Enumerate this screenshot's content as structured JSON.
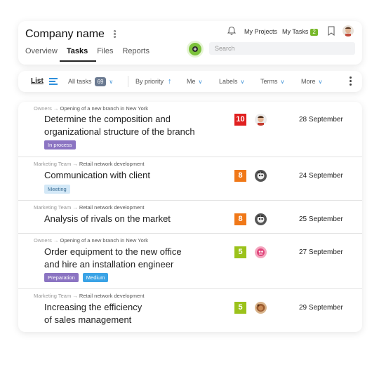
{
  "header": {
    "company_name": "Company name",
    "tabs": [
      {
        "label": "Overview",
        "active": false
      },
      {
        "label": "Tasks",
        "active": true
      },
      {
        "label": "Files",
        "active": false
      },
      {
        "label": "Reports",
        "active": false
      }
    ],
    "my_projects": "My Projects",
    "my_tasks": "My Tasks",
    "my_tasks_count": "2",
    "search_placeholder": "Search"
  },
  "toolbar": {
    "list_label": "List",
    "all_tasks_label": "All tasks",
    "all_tasks_count": "69",
    "sort_label": "By priority",
    "me_label": "Me",
    "labels_label": "Labels",
    "terms_label": "Terms",
    "more_label": "More"
  },
  "tasks": [
    {
      "crumb_a": "Owners",
      "crumb_b": "Opening of a new branch in New York",
      "title_1": "Determine the composition and",
      "title_2": "organizational structure of the branch",
      "labels": [
        {
          "text": "In process",
          "bg": "#8b74c2",
          "color": "#ffffff"
        }
      ],
      "priority": "10",
      "priority_color": "#e02020",
      "date": "28 September"
    },
    {
      "crumb_a": "Marketing Team",
      "crumb_b": "Retail network development",
      "title_1": "Communication with client",
      "title_2": "",
      "labels": [
        {
          "text": "Meeting",
          "bg": "#d3e8f7",
          "color": "#3a6d94"
        }
      ],
      "priority": "8",
      "priority_color": "#f07818",
      "date": "24 September"
    },
    {
      "crumb_a": "Marketing Team",
      "crumb_b": "Retail network development",
      "title_1": "Analysis of rivals on the market",
      "title_2": "",
      "labels": [],
      "priority": "8",
      "priority_color": "#f07818",
      "date": "25 September"
    },
    {
      "crumb_a": "Owners",
      "crumb_b": "Opening of a new branch in New York",
      "title_1": "Order equipment to the new office",
      "title_2": "and hire an  installation engineer",
      "labels": [
        {
          "text": "Preparation",
          "bg": "#8b74c2",
          "color": "#ffffff"
        },
        {
          "text": "Medium",
          "bg": "#3aa3e6",
          "color": "#ffffff"
        }
      ],
      "priority": "5",
      "priority_color": "#9bc21b",
      "date": "27 September"
    },
    {
      "crumb_a": "Marketing Team",
      "crumb_b": "Retail network development",
      "title_1": "Increasing the efficiency",
      "title_2": "of sales management",
      "labels": [],
      "priority": "5",
      "priority_color": "#9bc21b",
      "date": "29 September"
    }
  ]
}
